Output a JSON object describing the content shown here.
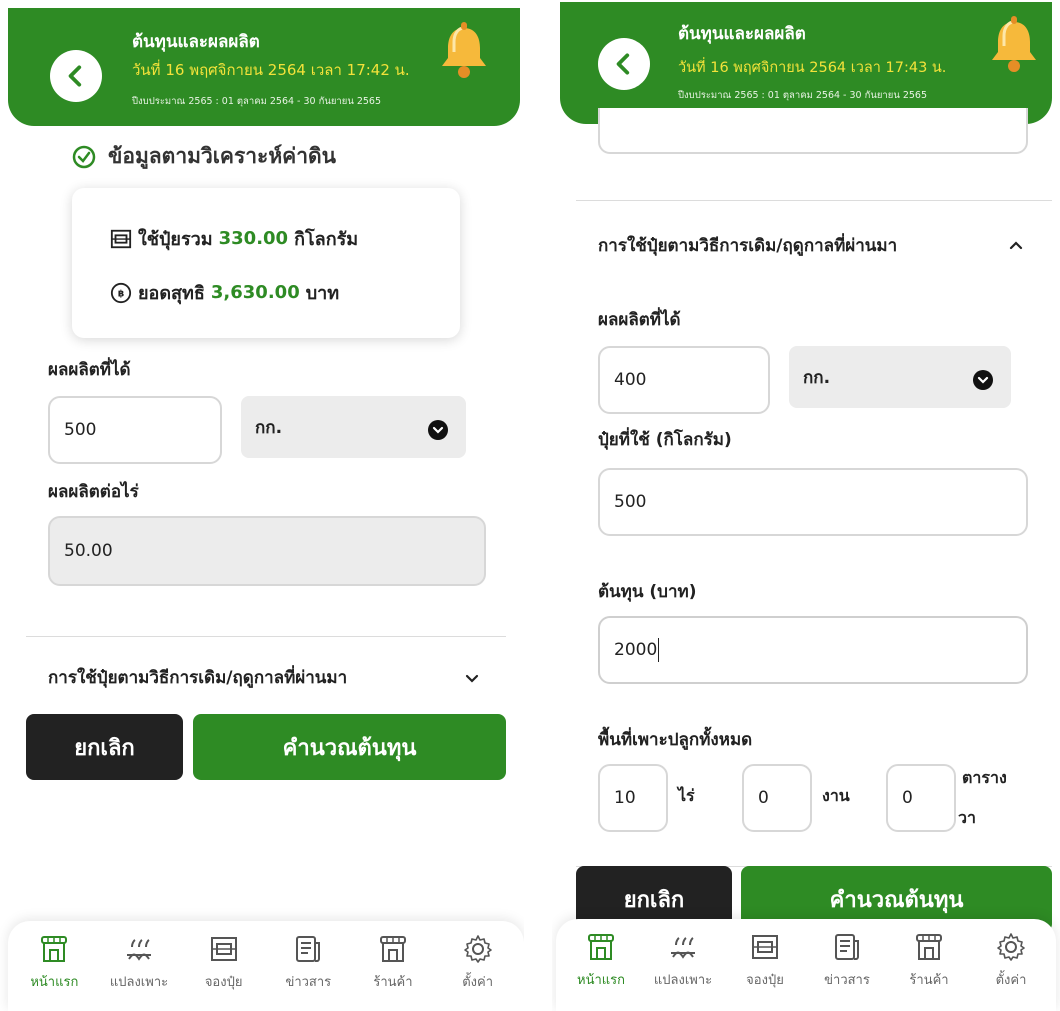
{
  "header": {
    "title": "ต้นทุนและผลผลิต",
    "date_left": "วันที่ 16 พฤศจิกายน 2564 เวลา 17:42 น.",
    "date_right": "วันที่ 16 พฤศจิกายน 2564 เวลา 17:43 น.",
    "budget_period": "ปีงบประมาณ 2565 : 01 ตุลาคม 2564 - 30 กันยายน 2565"
  },
  "left": {
    "section_title": "ข้อมูลตามวิเคราะห์ค่าดิน",
    "summary": {
      "fertilizer_prefix": "ใช้ปุ๋ยรวม",
      "fertilizer_value": "330.00",
      "fertilizer_unit": "กิโลกรัม",
      "net_prefix": "ยอดสุทธิ",
      "net_value": "3,630.00",
      "net_unit": "บาท"
    },
    "yield_label": "ผลผลิตที่ได้",
    "yield_value": "500",
    "yield_unit": "กก.",
    "yield_per_rai_label": "ผลผลิตต่อไร่",
    "yield_per_rai_value": "50.00",
    "accordion_label": "การใช้ปุ๋ยตามวิธีการเดิม/ฤดูกาลที่ผ่านมา",
    "cancel_label": "ยกเลิก",
    "calc_label": "คำนวณต้นทุน"
  },
  "right": {
    "accordion_label": "การใช้ปุ๋ยตามวิธีการเดิม/ฤดูกาลที่ผ่านมา",
    "yield_label": "ผลผลิตที่ได้",
    "yield_value": "400",
    "yield_unit": "กก.",
    "fertilizer_label": "ปุ๋ยที่ใช้ (กิโลกรัม)",
    "fertilizer_value": "500",
    "cost_label": "ต้นทุน (บาท)",
    "cost_value": "2000",
    "area_label": "พื้นที่เพาะปลูกทั้งหมด",
    "area_rai_value": "10",
    "area_rai_unit": "ไร่",
    "area_ngan_value": "0",
    "area_ngan_unit": "งาน",
    "area_wa_value": "0",
    "area_wa_unit_1": "ตาราง",
    "area_wa_unit_2": "วา",
    "cancel_label": "ยกเลิก",
    "calc_label": "คำนวณต้นทุน"
  },
  "nav": {
    "items": [
      {
        "label": "หน้าแรก",
        "icon": "store-icon"
      },
      {
        "label": "แปลงเพาะ",
        "icon": "plant-icon"
      },
      {
        "label": "จองปุ๋ย",
        "icon": "fertilizer-bag-icon"
      },
      {
        "label": "ข่าวสาร",
        "icon": "news-icon"
      },
      {
        "label": "ร้านค้า",
        "icon": "shop-icon"
      },
      {
        "label": "ตั้งค่า",
        "icon": "gear-icon"
      }
    ]
  },
  "colors": {
    "brand_green": "#2e8b24",
    "date_yellow": "#f3e23a",
    "cancel_dark": "#222222"
  }
}
